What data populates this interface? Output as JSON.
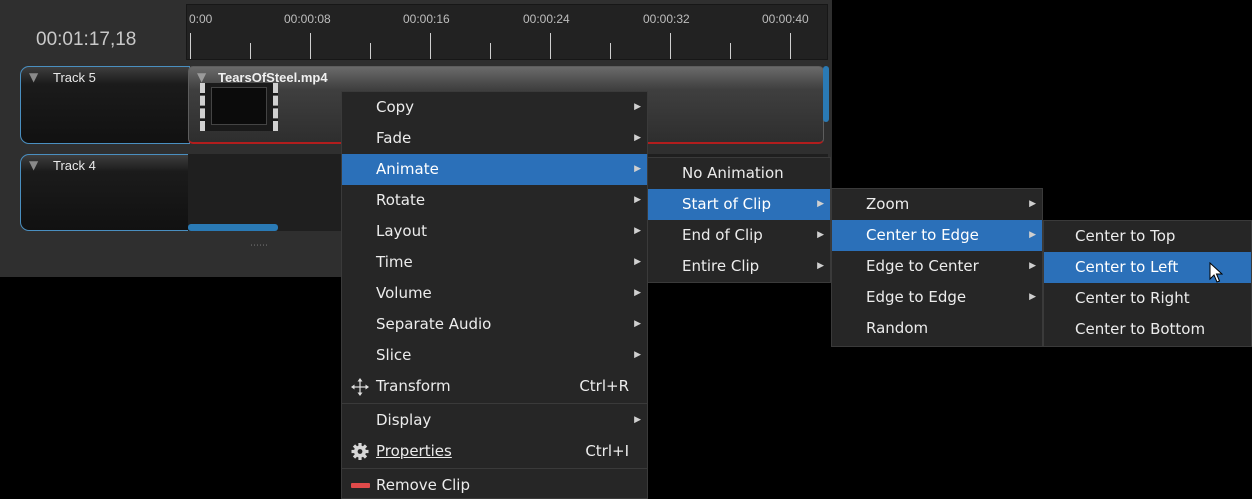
{
  "timeline": {
    "timecode": "00:01:17,18",
    "ruler_labels": [
      "0:00",
      "00:00:08",
      "00:00:16",
      "00:00:24",
      "00:00:32",
      "00:00:40"
    ],
    "tracks": [
      {
        "name": "Track 5"
      },
      {
        "name": "Track 4"
      }
    ],
    "clip": {
      "name": "TearsOfSteel.mp4"
    },
    "colors": {
      "accent": "#2b70b9",
      "clip_border": "#b21d1d"
    }
  },
  "context_menu": {
    "items": [
      {
        "label": "Copy",
        "submenu": true
      },
      {
        "label": "Fade",
        "submenu": true
      },
      {
        "label": "Animate",
        "submenu": true,
        "highlighted": true
      },
      {
        "label": "Rotate",
        "submenu": true
      },
      {
        "label": "Layout",
        "submenu": true
      },
      {
        "label": "Time",
        "submenu": true
      },
      {
        "label": "Volume",
        "submenu": true
      },
      {
        "label": "Separate Audio",
        "submenu": true
      },
      {
        "label": "Slice",
        "submenu": true
      },
      {
        "label": "Transform",
        "shortcut": "Ctrl+R",
        "icon": "move-arrows-icon"
      },
      {
        "label": "Display",
        "submenu": true
      },
      {
        "label": "Properties",
        "shortcut": "Ctrl+I",
        "icon": "gear-icon"
      },
      {
        "label": "Remove Clip",
        "icon": "remove-icon"
      }
    ]
  },
  "animate_menu": {
    "items": [
      {
        "label": "No Animation"
      },
      {
        "label": "Start of Clip",
        "submenu": true,
        "highlighted": true
      },
      {
        "label": "End of Clip",
        "submenu": true
      },
      {
        "label": "Entire Clip",
        "submenu": true
      }
    ]
  },
  "start_menu": {
    "items": [
      {
        "label": "Zoom",
        "submenu": true
      },
      {
        "label": "Center to Edge",
        "submenu": true,
        "highlighted": true
      },
      {
        "label": "Edge to Center",
        "submenu": true
      },
      {
        "label": "Edge to Edge",
        "submenu": true
      },
      {
        "label": "Random"
      }
    ]
  },
  "edge_menu": {
    "items": [
      {
        "label": "Center to Top"
      },
      {
        "label": "Center to Left",
        "highlighted": true
      },
      {
        "label": "Center to Right"
      },
      {
        "label": "Center to Bottom"
      }
    ]
  }
}
